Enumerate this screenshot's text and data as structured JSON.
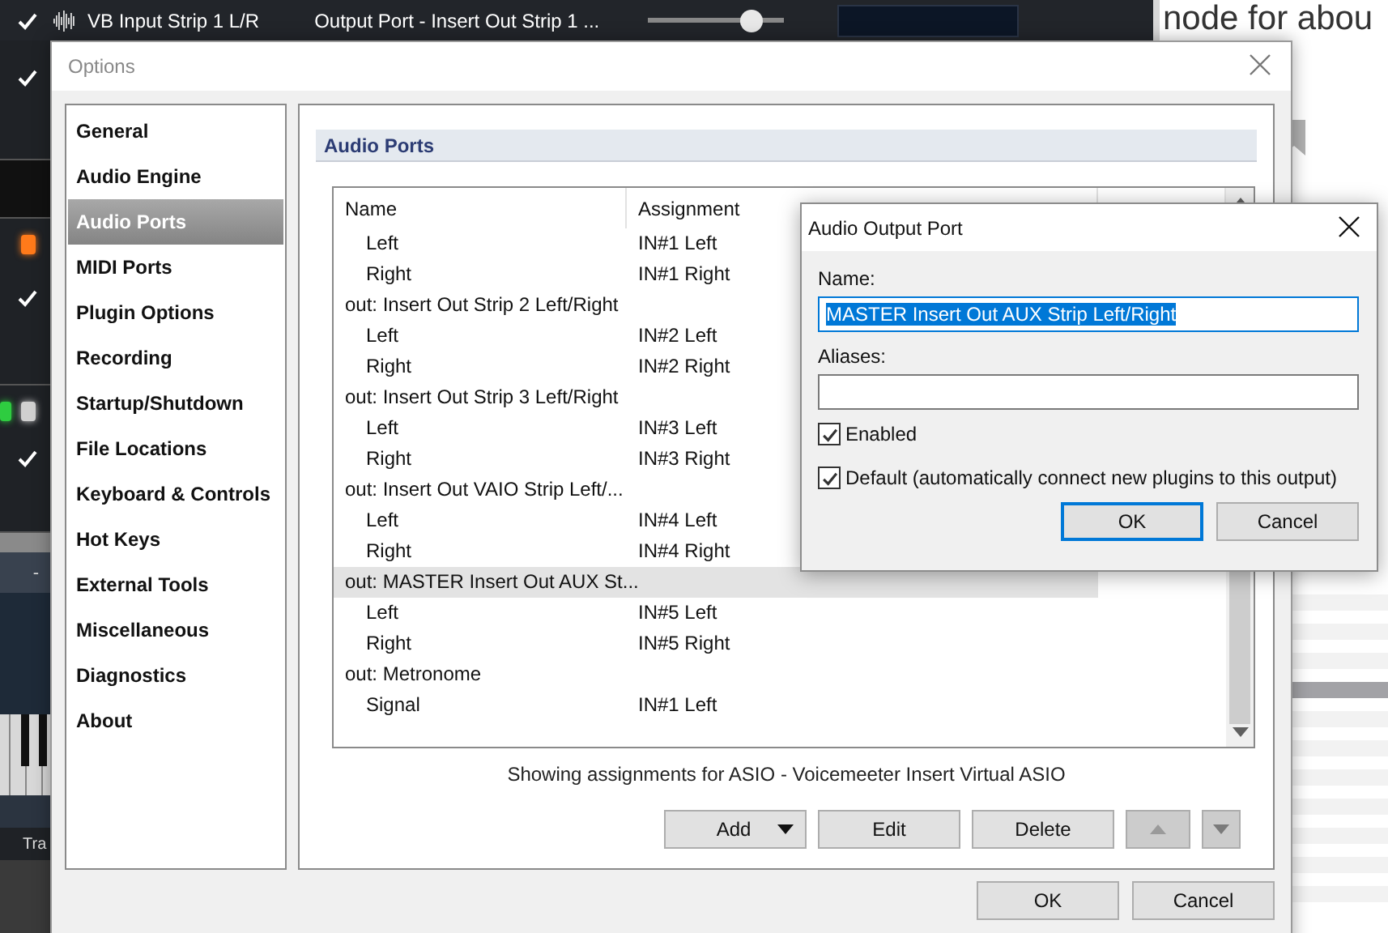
{
  "background_app": {
    "track": {
      "name": "VB Input Strip 1 L/R",
      "output": "Output Port - Insert Out Strip 1 ...",
      "volume": {
        "level": 0.76
      }
    },
    "side_label": "-",
    "bottom_label": "Tra"
  },
  "web_page": {
    "heading": "node for abou"
  },
  "options_window": {
    "title": "Options",
    "sidebar": {
      "items": [
        {
          "label": "General",
          "selected": false
        },
        {
          "label": "Audio Engine",
          "selected": false
        },
        {
          "label": "Audio Ports",
          "selected": true
        },
        {
          "label": "MIDI Ports",
          "selected": false
        },
        {
          "label": "Plugin Options",
          "selected": false
        },
        {
          "label": "Recording",
          "selected": false
        },
        {
          "label": "Startup/Shutdown",
          "selected": false
        },
        {
          "label": "File Locations",
          "selected": false
        },
        {
          "label": "Keyboard & Controls",
          "selected": false
        },
        {
          "label": "Hot Keys",
          "selected": false
        },
        {
          "label": "External Tools",
          "selected": false
        },
        {
          "label": "Miscellaneous",
          "selected": false
        },
        {
          "label": "Diagnostics",
          "selected": false
        },
        {
          "label": "About",
          "selected": false
        }
      ]
    },
    "panel": {
      "title": "Audio Ports",
      "table": {
        "columns": [
          "Name",
          "Assignment"
        ],
        "rows": [
          {
            "children": [
              {
                "name": "Left",
                "assignment": "IN#1 Left",
                "selected": false
              },
              {
                "name": "Right",
                "assignment": "IN#1 Right",
                "selected": false
              }
            ]
          },
          {
            "name": "out: Insert Out Strip 2 Left/Right",
            "selected": false,
            "children": [
              {
                "name": "Left",
                "assignment": "IN#2 Left",
                "selected": false
              },
              {
                "name": "Right",
                "assignment": "IN#2 Right",
                "selected": false
              }
            ]
          },
          {
            "name": "out: Insert Out Strip 3 Left/Right",
            "selected": false,
            "children": [
              {
                "name": "Left",
                "assignment": "IN#3 Left",
                "selected": false
              },
              {
                "name": "Right",
                "assignment": "IN#3 Right",
                "selected": false
              }
            ]
          },
          {
            "name": "out: Insert Out VAIO Strip Left/...",
            "selected": false,
            "children": [
              {
                "name": "Left",
                "assignment": "IN#4 Left",
                "selected": false
              },
              {
                "name": "Right",
                "assignment": "IN#4 Right",
                "selected": false
              }
            ]
          },
          {
            "name": "out: MASTER Insert Out AUX St...",
            "selected": true,
            "children": [
              {
                "name": "Left",
                "assignment": "IN#5 Left",
                "selected": false
              },
              {
                "name": "Right",
                "assignment": "IN#5 Right",
                "selected": false
              }
            ]
          },
          {
            "name": "out: Metronome",
            "selected": false,
            "children": [
              {
                "name": "Signal",
                "assignment": "IN#1 Left",
                "selected": false
              }
            ]
          }
        ]
      },
      "status": "Showing assignments for ASIO - Voicemeeter Insert Virtual ASIO",
      "buttons": [
        {
          "kind": "dropdown",
          "label": "Add",
          "disabled": false
        },
        {
          "kind": "text",
          "label": "Edit",
          "disabled": false
        },
        {
          "kind": "text",
          "label": "Delete",
          "disabled": false
        },
        {
          "kind": "move-up",
          "disabled": true
        },
        {
          "kind": "move-down",
          "disabled": true
        }
      ]
    },
    "buttons": [
      "OK",
      "Cancel"
    ]
  },
  "port_dialog": {
    "title": "Audio Output Port",
    "name_label": "Name:",
    "name_value": "MASTER Insert Out AUX Strip Left/Right",
    "aliases_label": "Aliases:",
    "checkboxes": [
      {
        "label": "Enabled",
        "checked": true
      },
      {
        "label": "Default (automatically connect new plugins to this output)",
        "checked": true
      }
    ],
    "buttons": [
      {
        "label": "OK",
        "default": true
      },
      {
        "label": "Cancel",
        "default": false
      }
    ]
  }
}
